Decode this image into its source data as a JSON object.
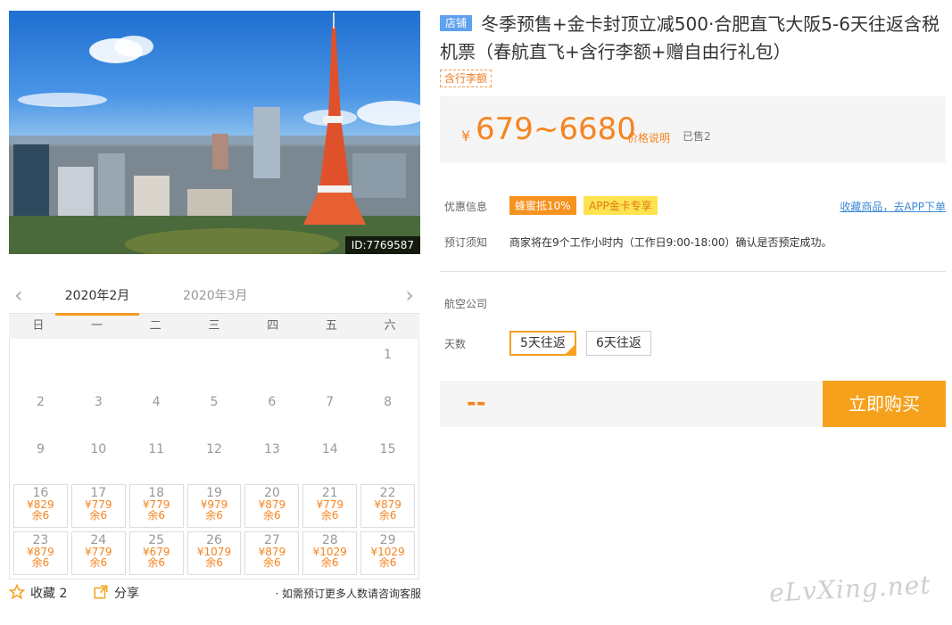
{
  "hero": {
    "id_label": "ID:7769587"
  },
  "calendar": {
    "prev_arrow": "‹",
    "next_arrow": "›",
    "tab_active": "2020年2月",
    "tab_inactive": "2020年3月",
    "weekdays": [
      "日",
      "一",
      "二",
      "三",
      "四",
      "五",
      "六"
    ],
    "plain_rows": [
      [
        "",
        "",
        "",
        "",
        "",
        "",
        "1"
      ],
      [
        "2",
        "3",
        "4",
        "5",
        "6",
        "7",
        "8"
      ],
      [
        "9",
        "10",
        "11",
        "12",
        "13",
        "14",
        "15"
      ]
    ],
    "avail_rows": [
      [
        {
          "day": "16",
          "price": "¥829",
          "remain": "余6"
        },
        {
          "day": "17",
          "price": "¥779",
          "remain": "余6"
        },
        {
          "day": "18",
          "price": "¥779",
          "remain": "余6"
        },
        {
          "day": "19",
          "price": "¥979",
          "remain": "余6"
        },
        {
          "day": "20",
          "price": "¥879",
          "remain": "余6"
        },
        {
          "day": "21",
          "price": "¥779",
          "remain": "余6"
        },
        {
          "day": "22",
          "price": "¥879",
          "remain": "余6"
        }
      ],
      [
        {
          "day": "23",
          "price": "¥879",
          "remain": "余6"
        },
        {
          "day": "24",
          "price": "¥779",
          "remain": "余6"
        },
        {
          "day": "25",
          "price": "¥679",
          "remain": "余6"
        },
        {
          "day": "26",
          "price": "¥1079",
          "remain": "余6"
        },
        {
          "day": "27",
          "price": "¥879",
          "remain": "余6"
        },
        {
          "day": "28",
          "price": "¥1029",
          "remain": "余6"
        },
        {
          "day": "29",
          "price": "¥1029",
          "remain": "余6"
        }
      ]
    ]
  },
  "bottom": {
    "fav_label": "收藏 2",
    "share_label": "分享",
    "note": "· 如需预订更多人数请咨询客服"
  },
  "product": {
    "shop_badge": "店铺",
    "title": "冬季预售+金卡封顶立减500·合肥直飞大阪5-6天往返含税机票（春航直飞+含行李额+赠自由行礼包）",
    "tag": "含行李额"
  },
  "price": {
    "currency": "¥",
    "value": "679~6680",
    "explain": "价格说明",
    "sold": "已售2"
  },
  "offers": {
    "label": "优惠信息",
    "coupon1": "蜂蜜抵10%",
    "coupon2": "APP金卡专享",
    "app_link": "收藏商品，去APP下单"
  },
  "booking": {
    "label": "预订须知",
    "text": "商家将在9个工作小时内（工作日9:00-18:00）确认是否预定成功。"
  },
  "options": {
    "airline_label": "航空公司",
    "days_label": "天数",
    "day_option_1": "5天往返",
    "day_option_2": "6天往返"
  },
  "buy": {
    "price_placeholder": "--",
    "button": "立即购买"
  },
  "watermark": "eLvXing.net",
  "colors": {
    "accent_orange": "#f68420",
    "buy_button": "#f6a11c",
    "shop_badge_blue": "#5ea1ee",
    "coupon_yellow": "#fde34f",
    "link_blue": "#3c88d6"
  }
}
